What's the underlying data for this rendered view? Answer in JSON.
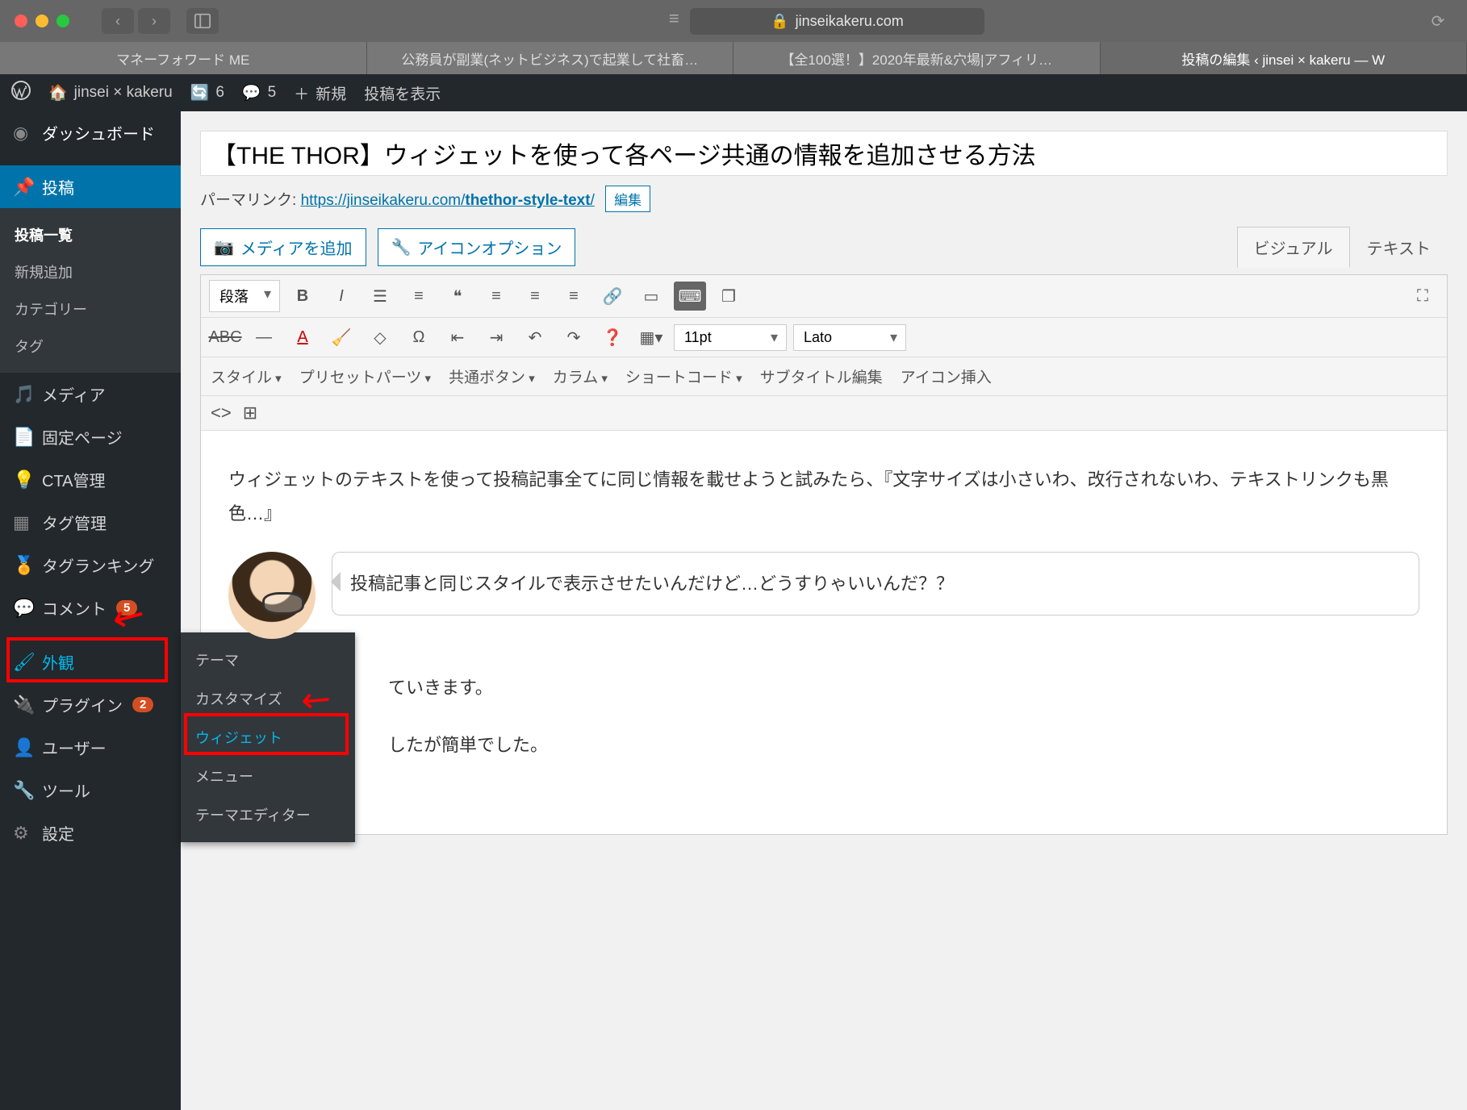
{
  "browser": {
    "url_host": "jinseikakeru.com",
    "tabs": [
      "マネーフォワード ME",
      "公務員が副業(ネットビジネス)で起業して社畜…",
      "【全100選！】2020年最新&穴場|アフィリ…",
      "投稿の編集 ‹ jinsei × kakeru — W"
    ]
  },
  "wpbar": {
    "site": "jinsei × kakeru",
    "updates": "6",
    "comments": "5",
    "new": "新規",
    "view": "投稿を表示"
  },
  "sidebar": {
    "dashboard": "ダッシュボード",
    "posts": "投稿",
    "posts_sub": [
      "投稿一覧",
      "新規追加",
      "カテゴリー",
      "タグ"
    ],
    "media": "メディア",
    "pages": "固定ページ",
    "cta": "CTA管理",
    "tag_mgmt": "タグ管理",
    "tag_rank": "タグランキング",
    "comments": "コメント",
    "comments_badge": "5",
    "appearance": "外観",
    "plugins": "プラグイン",
    "plugins_badge": "2",
    "users": "ユーザー",
    "tools": "ツール",
    "settings": "設定"
  },
  "flyout": {
    "items": [
      "テーマ",
      "カスタマイズ",
      "ウィジェット",
      "メニュー",
      "テーマエディター"
    ]
  },
  "post": {
    "title": "【THE THOR】ウィジェットを使って各ページ共通の情報を追加させる方法",
    "permalink_label": "パーマリンク: ",
    "permalink_base": "https://jinseikakeru.com/",
    "permalink_slug": "thethor-style-text",
    "edit": "編集"
  },
  "editor": {
    "media_btn": "メディアを追加",
    "icon_btn": "アイコンオプション",
    "tab_visual": "ビジュアル",
    "tab_text": "テキスト",
    "format": "段落",
    "font_size": "11pt",
    "font_family": "Lato",
    "styles": [
      "スタイル",
      "プリセットパーツ",
      "共通ボタン",
      "カラム",
      "ショートコード",
      "サブタイトル編集",
      "アイコン挿入"
    ]
  },
  "body": {
    "p1": "ウィジェットのテキストを使って投稿記事全てに同じ情報を載せようと試みたら、『文字サイズは小さいわ、改行されないわ、テキストリンクも黒色…』",
    "bubble": "投稿記事と同じスタイルで表示させたいんだけど…どうすりゃいいんだ？？",
    "p2_tail": "ていきます。",
    "p3_tail": "したが簡単でした。"
  }
}
